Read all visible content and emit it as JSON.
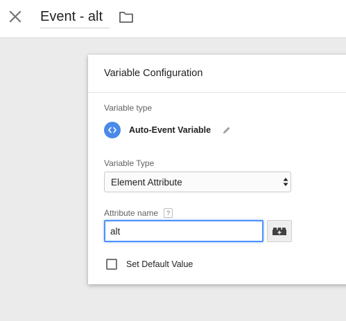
{
  "header": {
    "title": "Event - alt",
    "close_icon": "close-icon",
    "folder_icon": "folder-icon"
  },
  "panel": {
    "title": "Variable Configuration",
    "variable_type_label": "Variable type",
    "variable_type_name": "Auto-Event Variable",
    "variable_type_icon": "code-icon",
    "variable_type_icon_color": "#4a8ae8",
    "edit_icon": "pencil-icon",
    "type_select_label": "Variable Type",
    "type_select_value": "Element Attribute",
    "attribute_name_label": "Attribute name",
    "help_badge": "?",
    "attribute_name_value": "alt",
    "variable_picker_icon": "lego-brick-icon",
    "default_value_checkbox_label": "Set Default Value",
    "default_value_checked": false
  }
}
